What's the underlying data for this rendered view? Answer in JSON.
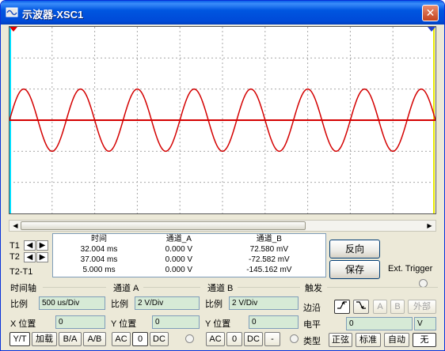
{
  "window": {
    "title": "示波器-XSC1",
    "close": "✕"
  },
  "colors": {
    "trace": "#d40000",
    "grid": "#a8a8a8",
    "cursor1": "#00e0ff",
    "cursor2": "#e8e800"
  },
  "waveform": {
    "cycles": 7.5,
    "amplitude_div": 1.0
  },
  "cursors": {
    "t1_label": "T1",
    "t2_label": "T2",
    "t2t1_label": "T2-T1",
    "headers": [
      "时间",
      "通道_A",
      "通道_B"
    ],
    "rows": [
      [
        "32.004 ms",
        "0.000 V",
        "72.580 mV"
      ],
      [
        "37.004 ms",
        "0.000 V",
        "-72.582 mV"
      ],
      [
        "5.000 ms",
        "0.000 V",
        "-145.162 mV"
      ]
    ]
  },
  "buttons": {
    "reverse": "反向",
    "save": "保存",
    "ext_trigger": "Ext. Trigger"
  },
  "timebase": {
    "title": "时间轴",
    "scale_label": "比例",
    "scale": "500 us/Div",
    "xpos_label": "X 位置",
    "xpos": "0",
    "modes": [
      "Y/T",
      "加载",
      "B/A",
      "A/B"
    ]
  },
  "channel_a": {
    "title": "通道 A",
    "scale_label": "比例",
    "scale": "2  V/Div",
    "ypos_label": "Y 位置",
    "ypos": "0",
    "coupling": [
      "AC",
      "0",
      "DC"
    ]
  },
  "channel_b": {
    "title": "通道 B",
    "scale_label": "比例",
    "scale": "2  V/Div",
    "ypos_label": "Y 位置",
    "ypos": "0",
    "coupling": [
      "AC",
      "0",
      "DC",
      "-"
    ]
  },
  "trigger": {
    "title": "触发",
    "edge_label": "边沿",
    "level_label": "电平",
    "type_label": "类型",
    "sources": [
      "A",
      "B",
      "外部"
    ],
    "level": "0",
    "level_unit": "V",
    "types": [
      "正弦",
      "标准",
      "自动",
      "无"
    ]
  }
}
